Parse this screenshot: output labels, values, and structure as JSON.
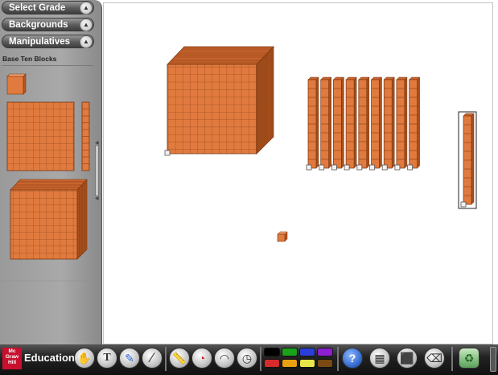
{
  "sidebar": {
    "menu": [
      {
        "label": "Select Grade",
        "icon": "chevron-up-icon"
      },
      {
        "label": "Backgrounds",
        "icon": "chevron-up-icon"
      },
      {
        "label": "Manipulatives",
        "icon": "chevron-up-icon"
      }
    ],
    "panel_title": "Base Ten Blocks",
    "palette": [
      "unit-cube",
      "hundred-flat",
      "ten-rod",
      "thousand-cube"
    ]
  },
  "workspace": {
    "blocks": [
      {
        "type": "thousand-cube",
        "count": 1
      },
      {
        "type": "ten-rod",
        "count": 9
      },
      {
        "type": "ten-rod",
        "count": 1,
        "selected": true
      },
      {
        "type": "unit-cube",
        "count": 1
      }
    ]
  },
  "toolbar": {
    "brand_label": "Education",
    "logo_lines": [
      "Mc",
      "Graw",
      "Hill"
    ],
    "tools": [
      "hand-icon",
      "text-icon",
      "pen-icon",
      "line-icon",
      "ruler-icon",
      "timer-icon",
      "protractor-icon",
      "clock-icon"
    ],
    "text_tool_glyph": "T",
    "colors": [
      "#000000",
      "#1aa21a",
      "#2b3fd8",
      "#8e1fcf",
      "#d62b2b",
      "#e8a010",
      "#e8e84a",
      "#7a4a12"
    ],
    "right_tools": [
      "help-icon",
      "calendar-icon",
      "clear-icon",
      "eraser-icon",
      "trash-icon"
    ],
    "help_glyph": "?"
  }
}
